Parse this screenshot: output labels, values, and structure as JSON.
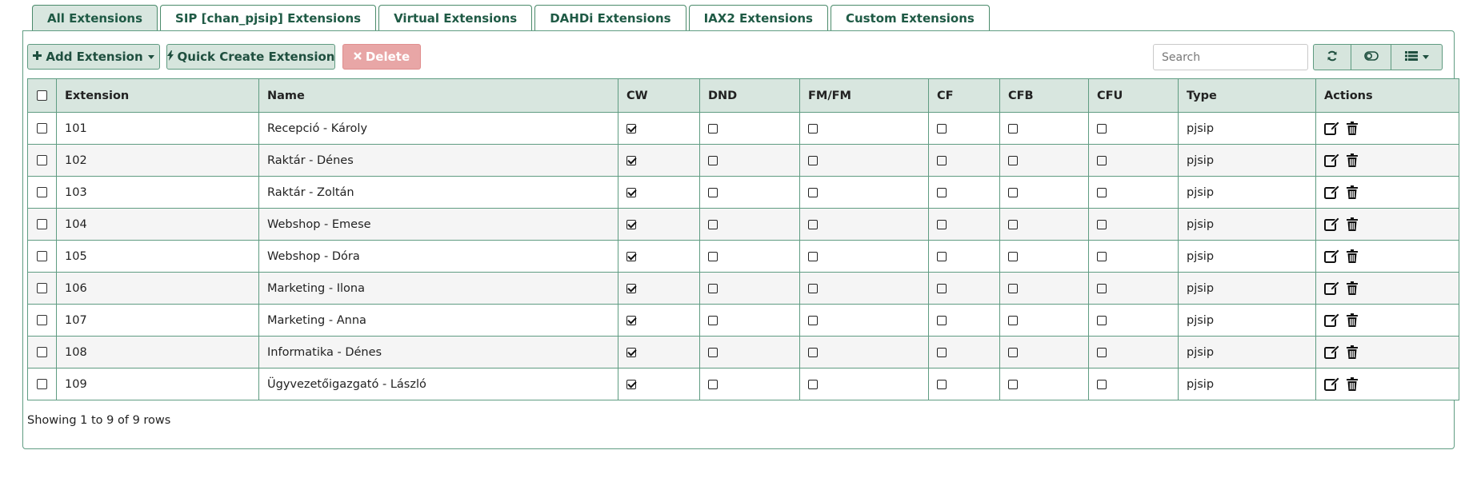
{
  "tabs": [
    {
      "label": "All Extensions",
      "active": true
    },
    {
      "label": "SIP [chan_pjsip] Extensions",
      "active": false
    },
    {
      "label": "Virtual Extensions",
      "active": false
    },
    {
      "label": "DAHDi Extensions",
      "active": false
    },
    {
      "label": "IAX2 Extensions",
      "active": false
    },
    {
      "label": "Custom Extensions",
      "active": false
    }
  ],
  "toolbar": {
    "add_label": "Add Extension",
    "quick_label": "Quick Create Extension",
    "delete_label": "Delete",
    "search_placeholder": "Search",
    "add_icon": "plus-icon",
    "quick_icon": "bolt-icon",
    "delete_icon": "times-icon",
    "refresh_icon": "refresh-icon",
    "toggle_icon": "toggle-icon",
    "columns_icon": "columns-list-icon"
  },
  "table": {
    "headers": [
      "Extension",
      "Name",
      "CW",
      "DND",
      "FM/FM",
      "CF",
      "CFB",
      "CFU",
      "Type",
      "Actions"
    ],
    "rows": [
      {
        "extension": "101",
        "name": "Recepció - Károly",
        "cw": true,
        "dnd": false,
        "fmfm": false,
        "cf": false,
        "cfb": false,
        "cfu": false,
        "type": "pjsip"
      },
      {
        "extension": "102",
        "name": "Raktár - Dénes",
        "cw": true,
        "dnd": false,
        "fmfm": false,
        "cf": false,
        "cfb": false,
        "cfu": false,
        "type": "pjsip"
      },
      {
        "extension": "103",
        "name": "Raktár - Zoltán",
        "cw": true,
        "dnd": false,
        "fmfm": false,
        "cf": false,
        "cfb": false,
        "cfu": false,
        "type": "pjsip"
      },
      {
        "extension": "104",
        "name": "Webshop - Emese",
        "cw": true,
        "dnd": false,
        "fmfm": false,
        "cf": false,
        "cfb": false,
        "cfu": false,
        "type": "pjsip"
      },
      {
        "extension": "105",
        "name": "Webshop - Dóra",
        "cw": true,
        "dnd": false,
        "fmfm": false,
        "cf": false,
        "cfb": false,
        "cfu": false,
        "type": "pjsip"
      },
      {
        "extension": "106",
        "name": "Marketing - Ilona",
        "cw": true,
        "dnd": false,
        "fmfm": false,
        "cf": false,
        "cfb": false,
        "cfu": false,
        "type": "pjsip"
      },
      {
        "extension": "107",
        "name": "Marketing - Anna",
        "cw": true,
        "dnd": false,
        "fmfm": false,
        "cf": false,
        "cfb": false,
        "cfu": false,
        "type": "pjsip"
      },
      {
        "extension": "108",
        "name": "Informatika - Dénes",
        "cw": true,
        "dnd": false,
        "fmfm": false,
        "cf": false,
        "cfb": false,
        "cfu": false,
        "type": "pjsip"
      },
      {
        "extension": "109",
        "name": "Ügyvezetőigazgató - László",
        "cw": true,
        "dnd": false,
        "fmfm": false,
        "cf": false,
        "cfb": false,
        "cfu": false,
        "type": "pjsip"
      }
    ],
    "action_icons": [
      "edit-icon",
      "trash-icon"
    ]
  },
  "footer": {
    "summary": "Showing 1 to 9 of 9 rows"
  },
  "colors": {
    "accent": "#5f9c82",
    "header_bg": "#d8e6df",
    "tab_text": "#1f5a45",
    "delete_bg": "#e8a6a6"
  }
}
